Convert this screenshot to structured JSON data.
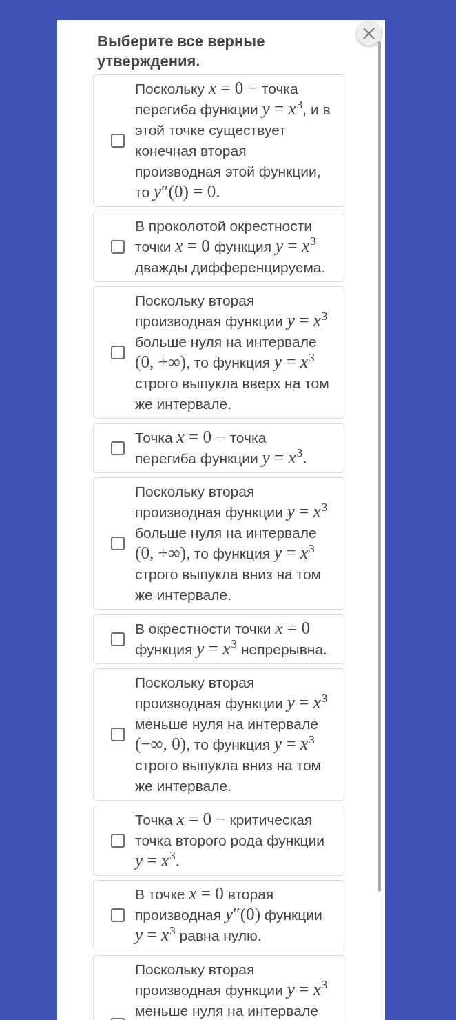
{
  "dialog": {
    "title": "Выберите все верные утверждения.",
    "options": [
      {
        "checked": false,
        "statement": [
          {
            "kind": "text",
            "text": "Поскольку "
          },
          {
            "kind": "math",
            "text": "*x* = 0 −"
          },
          {
            "kind": "text",
            "text": " точка\nперегиба функции "
          },
          {
            "kind": "math",
            "text": "*y* = *x*$^{3}$"
          },
          {
            "kind": "text",
            "text": ", и в\nэтой точке существует\nконечная вторая\nпроизводная этой функции,\nто "
          },
          {
            "kind": "math",
            "text": "*y*″(0) = 0."
          }
        ]
      },
      {
        "checked": false,
        "statement": [
          {
            "kind": "text",
            "text": "В проколотой окрестности\nточки "
          },
          {
            "kind": "math",
            "text": "*x* = 0"
          },
          {
            "kind": "text",
            "text": " функция "
          },
          {
            "kind": "math",
            "text": "*y* = *x*$^{3}$"
          },
          {
            "kind": "text",
            "text": "\nдважды дифференцируема."
          }
        ]
      },
      {
        "checked": false,
        "statement": [
          {
            "kind": "text",
            "text": "Поскольку вторая\nпроизводная функции "
          },
          {
            "kind": "math",
            "text": "*y* = *x*$^{3}$"
          },
          {
            "kind": "text",
            "text": "\nбольше нуля на интервале\n"
          },
          {
            "kind": "math",
            "text": "(0, +∞)"
          },
          {
            "kind": "text",
            "text": ", то функция "
          },
          {
            "kind": "math",
            "text": "*y* = *x*$^{3}$"
          },
          {
            "kind": "text",
            "text": "\nстрого выпукла вверх на том\nже интервале."
          }
        ]
      },
      {
        "checked": false,
        "statement": [
          {
            "kind": "text",
            "text": "Точка "
          },
          {
            "kind": "math",
            "text": "*x* = 0 −"
          },
          {
            "kind": "text",
            "text": " точка\nперегиба функции "
          },
          {
            "kind": "math",
            "text": "*y* = *x*$^{3}$."
          }
        ]
      },
      {
        "checked": false,
        "statement": [
          {
            "kind": "text",
            "text": "Поскольку вторая\nпроизводная функции "
          },
          {
            "kind": "math",
            "text": "*y* = *x*$^{3}$"
          },
          {
            "kind": "text",
            "text": "\nбольше нуля на интервале\n"
          },
          {
            "kind": "math",
            "text": "(0, +∞)"
          },
          {
            "kind": "text",
            "text": ", то функция "
          },
          {
            "kind": "math",
            "text": "*y* = *x*$^{3}$"
          },
          {
            "kind": "text",
            "text": "\nстрого выпукла вниз на том\nже интервале."
          }
        ]
      },
      {
        "checked": false,
        "statement": [
          {
            "kind": "text",
            "text": "В окрестности точки "
          },
          {
            "kind": "math",
            "text": "*x* = 0"
          },
          {
            "kind": "text",
            "text": "\nфункция "
          },
          {
            "kind": "math",
            "text": "*y* = *x*$^{3}$"
          },
          {
            "kind": "text",
            "text": " непрерывна."
          }
        ]
      },
      {
        "checked": false,
        "statement": [
          {
            "kind": "text",
            "text": "Поскольку вторая\nпроизводная функции "
          },
          {
            "kind": "math",
            "text": "*y* = *x*$^{3}$"
          },
          {
            "kind": "text",
            "text": "\nменьше нуля на интервале\n"
          },
          {
            "kind": "math",
            "text": "(−∞, 0)"
          },
          {
            "kind": "text",
            "text": ", то функция "
          },
          {
            "kind": "math",
            "text": "*y* = *x*$^{3}$"
          },
          {
            "kind": "text",
            "text": "\nстрого выпукла вниз на том\nже интервале."
          }
        ]
      },
      {
        "checked": false,
        "statement": [
          {
            "kind": "text",
            "text": "Точка "
          },
          {
            "kind": "math",
            "text": "*x* = 0 −"
          },
          {
            "kind": "text",
            "text": " критическая\nточка второго рода функции\n"
          },
          {
            "kind": "math",
            "text": "*y* = *x*$^{3}$."
          }
        ]
      },
      {
        "checked": false,
        "statement": [
          {
            "kind": "text",
            "text": "В точке "
          },
          {
            "kind": "math",
            "text": "*x* = 0"
          },
          {
            "kind": "text",
            "text": " вторая\nпроизводная "
          },
          {
            "kind": "math",
            "text": "*y*″(0)"
          },
          {
            "kind": "text",
            "text": " функции\n"
          },
          {
            "kind": "math",
            "text": "*y* = *x*$^{3}$"
          },
          {
            "kind": "text",
            "text": " равна нулю."
          }
        ]
      },
      {
        "checked": false,
        "statement": [
          {
            "kind": "text",
            "text": "Поскольку вторая\nпроизводная функции "
          },
          {
            "kind": "math",
            "text": "*y* = *x*$^{3}$"
          },
          {
            "kind": "text",
            "text": "\nменьше нуля на интервале"
          }
        ]
      }
    ]
  }
}
